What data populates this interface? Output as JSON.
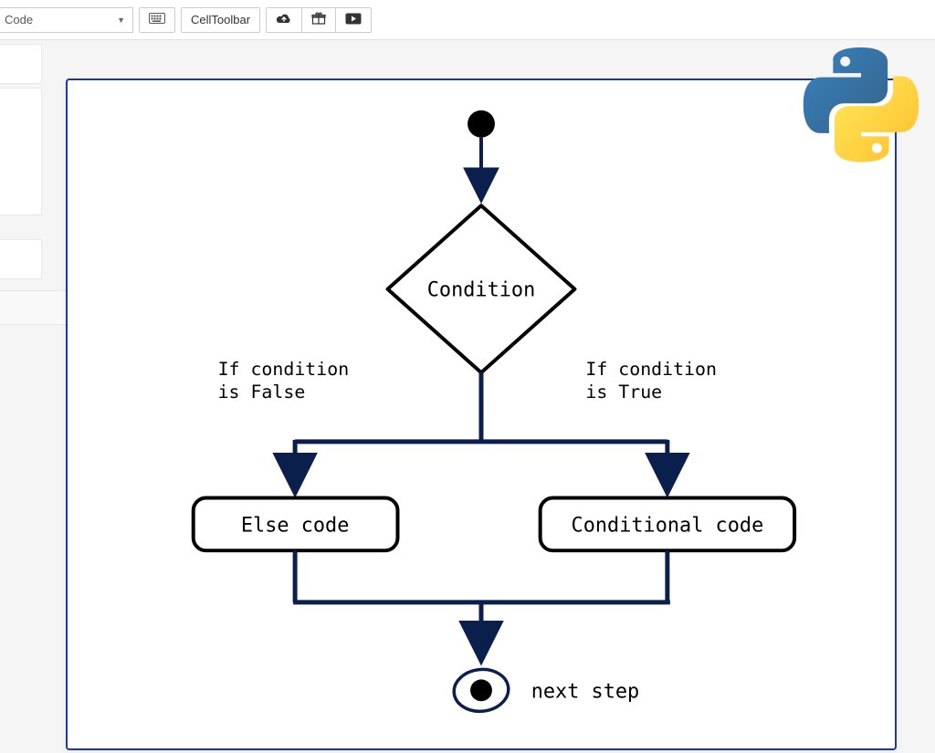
{
  "toolbar": {
    "cell_type": "Code",
    "cell_toolbar_label": "CellToolbar"
  },
  "diagram": {
    "condition_label": "Condition",
    "left_branch_line1": "If condition",
    "left_branch_line2": "is False",
    "right_branch_line1": "If condition",
    "right_branch_line2": "is True",
    "left_box_label": "Else code",
    "right_box_label": "Conditional code",
    "end_label": "next step"
  }
}
